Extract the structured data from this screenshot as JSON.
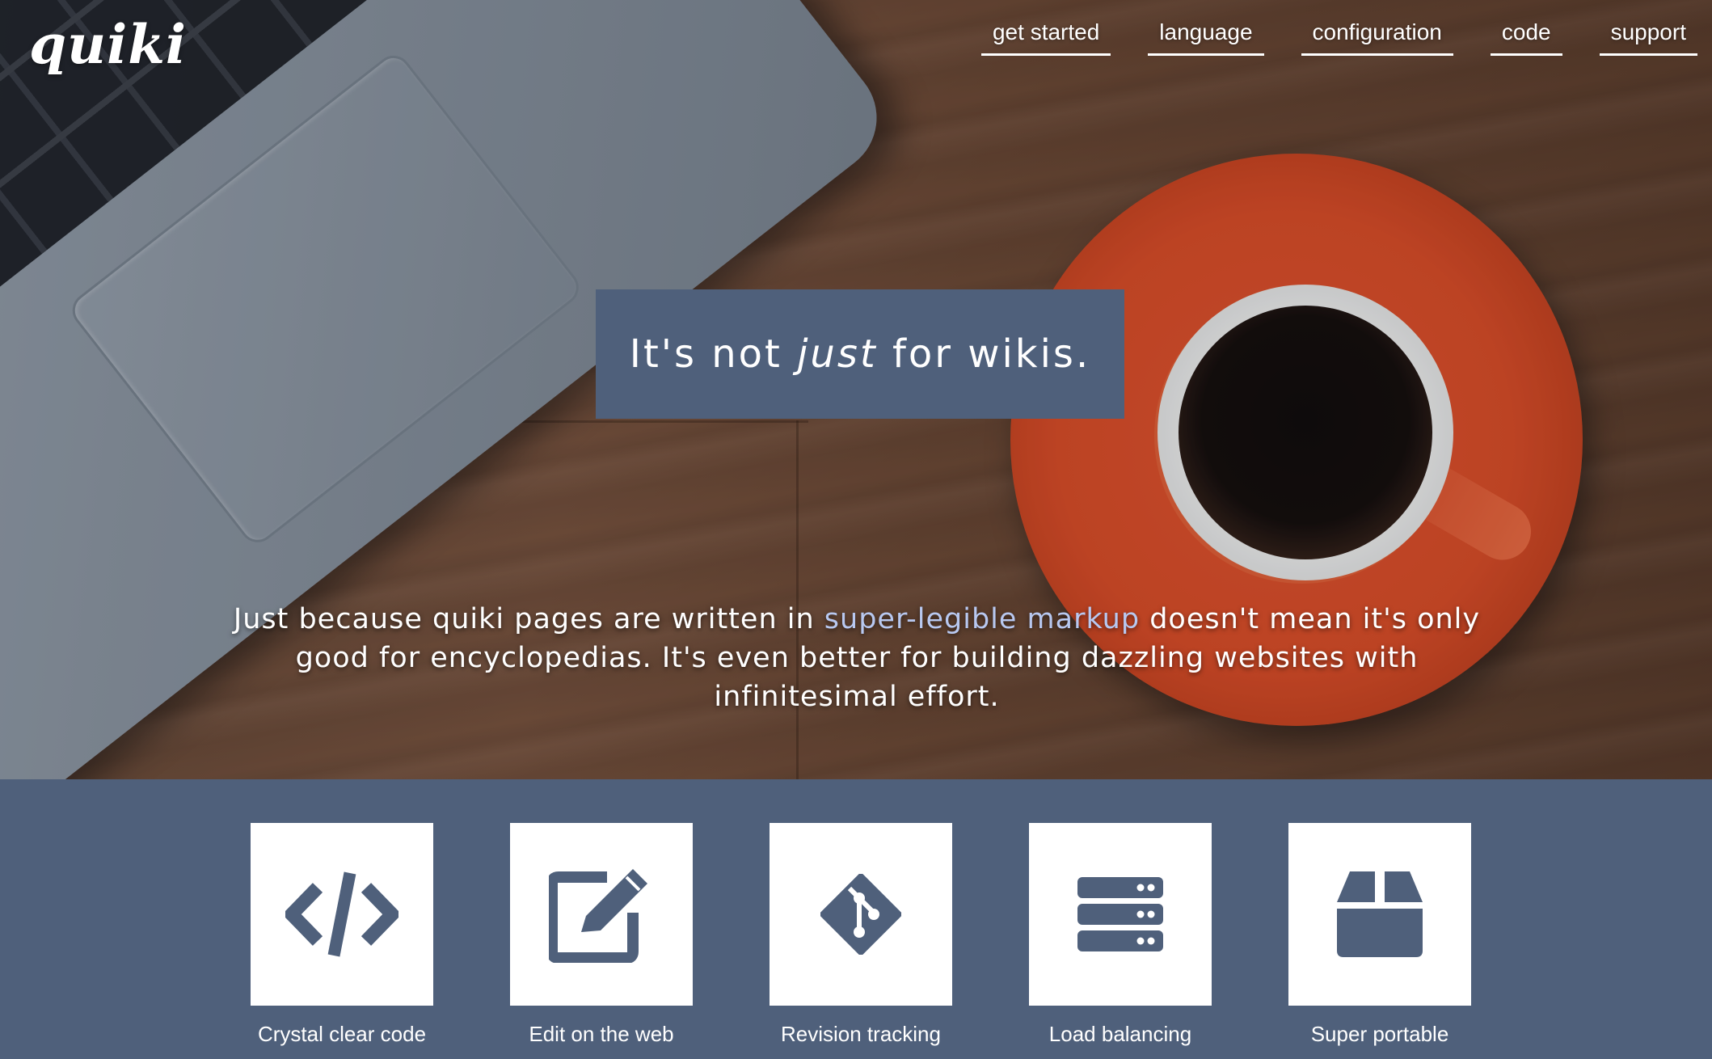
{
  "brand": {
    "logo_text": "quiki"
  },
  "nav": {
    "items": [
      {
        "label": "get started"
      },
      {
        "label": "language"
      },
      {
        "label": "configuration"
      },
      {
        "label": "code"
      },
      {
        "label": "support"
      }
    ]
  },
  "hero": {
    "headline_before": "It's not ",
    "headline_emphasis": "just",
    "headline_after": " for wikis.",
    "intro_before": "Just because quiki pages are written in ",
    "intro_link": "super-legible markup",
    "intro_after": " doesn't mean it's only good for encyclopedias. It's even better for building dazzling websites with infinitesimal effort."
  },
  "features": {
    "icon_color": "#4f607b",
    "items": [
      {
        "label": "Crystal clear code",
        "icon": "code-icon"
      },
      {
        "label": "Edit on the web",
        "icon": "edit-icon"
      },
      {
        "label": "Revision tracking",
        "icon": "git-icon"
      },
      {
        "label": "Load balancing",
        "icon": "server-icon"
      },
      {
        "label": "Super portable",
        "icon": "box-icon"
      }
    ]
  },
  "colors": {
    "panel": "#4f607b",
    "link": "#b8c8f0",
    "text": "#ffffff"
  }
}
